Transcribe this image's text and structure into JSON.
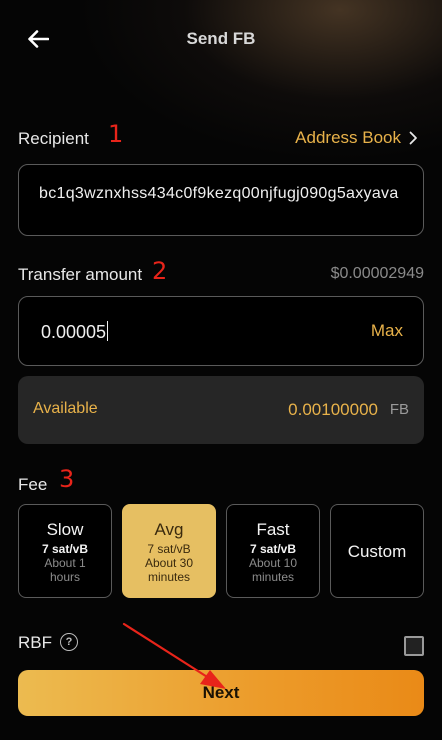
{
  "header": {
    "title": "Send FB"
  },
  "recipient": {
    "label": "Recipient",
    "annotation": "1",
    "address_book_label": "Address Book",
    "address": "bc1q3wznxhss434c0f9kezq00njfugj090g5axyava"
  },
  "transfer": {
    "label": "Transfer amount",
    "annotation": "2",
    "usd_value": "$0.00002949",
    "amount": "0.00005",
    "max_label": "Max"
  },
  "available": {
    "label": "Available",
    "value": "0.00100000",
    "unit": "FB"
  },
  "fee": {
    "label": "Fee",
    "annotation": "3",
    "options": [
      {
        "name": "Slow",
        "rate": "7 sat/vB",
        "time_line1": "About 1",
        "time_line2": "hours"
      },
      {
        "name": "Avg",
        "rate": "7 sat/vB",
        "time_line1": "About 30",
        "time_line2": "minutes"
      },
      {
        "name": "Fast",
        "rate": "7 sat/vB",
        "time_line1": "About 10",
        "time_line2": "minutes"
      },
      {
        "name": "Custom"
      }
    ],
    "selected": "Avg"
  },
  "rbf": {
    "label": "RBF",
    "checked": false
  },
  "next_label": "Next",
  "colors": {
    "accent": "#e8b24a",
    "selected_fee": "#e6bf62",
    "annotation": "#e8241a"
  }
}
